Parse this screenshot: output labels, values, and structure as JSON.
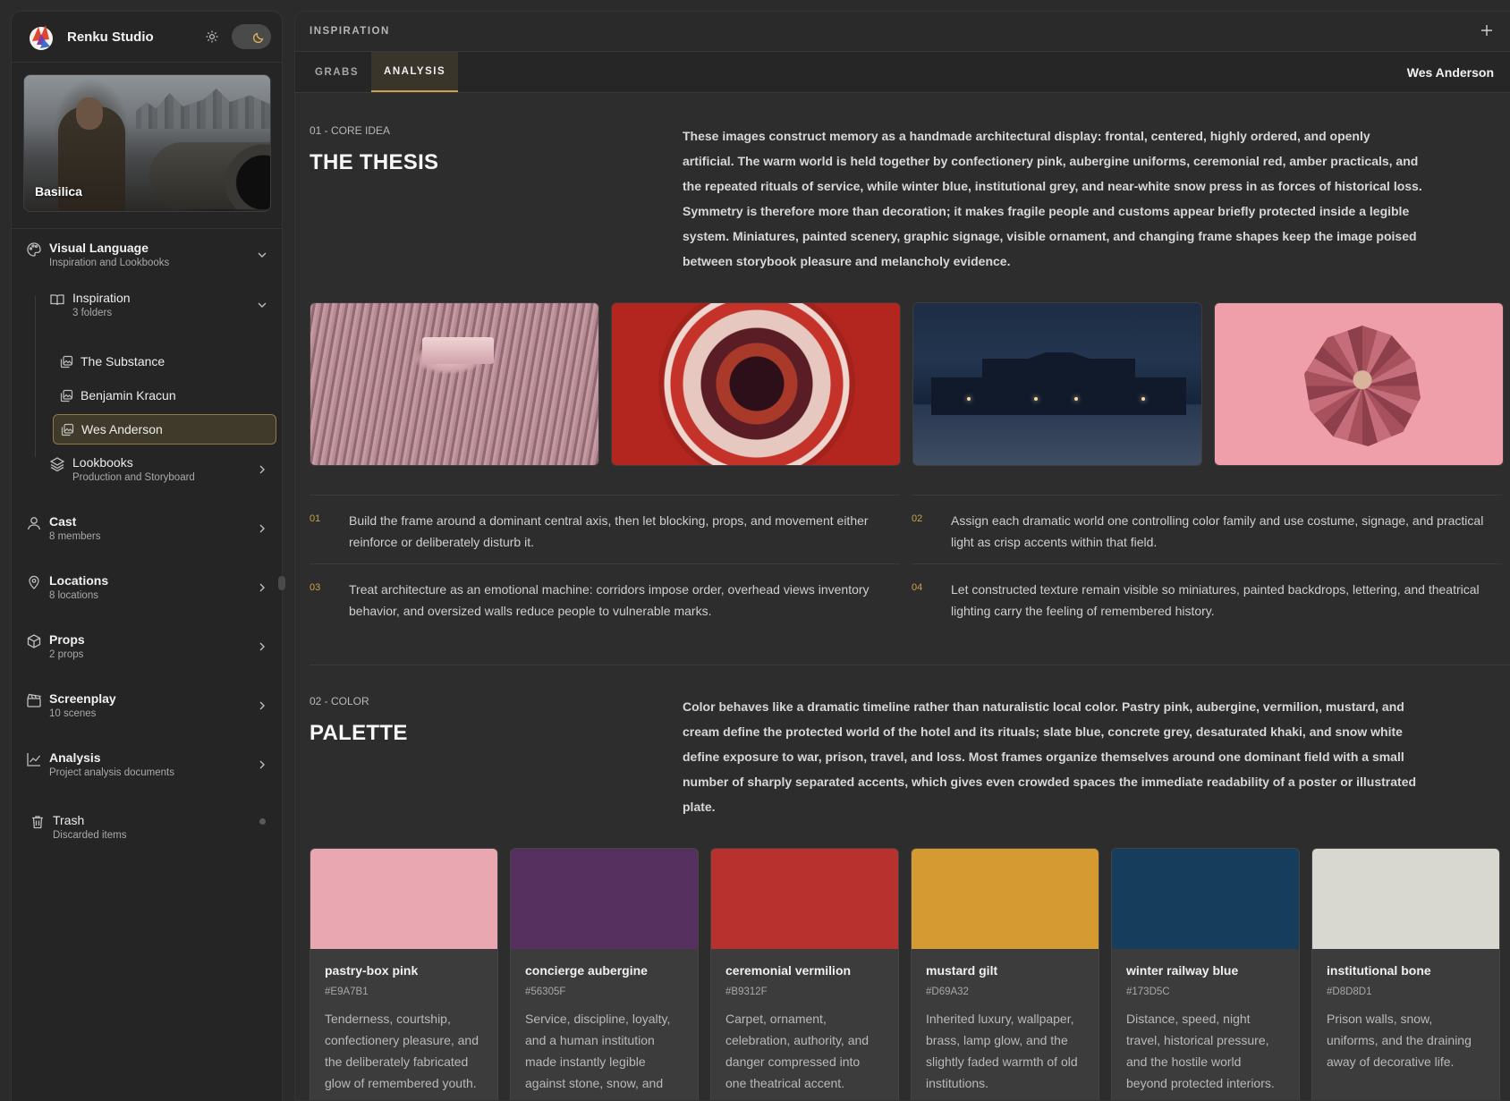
{
  "app": {
    "name": "Renku Studio"
  },
  "project": {
    "name": "Basilica"
  },
  "sidebar": {
    "visual_language": {
      "title": "Visual Language",
      "subtitle": "Inspiration and Lookbooks"
    },
    "inspiration": {
      "title": "Inspiration",
      "subtitle": "3 folders"
    },
    "folders": [
      "The Substance",
      "Benjamin Kracun",
      "Wes Anderson"
    ],
    "lookbooks": {
      "title": "Lookbooks",
      "subtitle": "Production and Storyboard"
    },
    "cast": {
      "title": "Cast",
      "subtitle": "8 members"
    },
    "locations": {
      "title": "Locations",
      "subtitle": "8 locations"
    },
    "props": {
      "title": "Props",
      "subtitle": "2 props"
    },
    "screenplay": {
      "title": "Screenplay",
      "subtitle": "10 scenes"
    },
    "analysis": {
      "title": "Analysis",
      "subtitle": "Project analysis documents"
    },
    "trash": {
      "title": "Trash",
      "subtitle": "Discarded items"
    }
  },
  "main": {
    "title": "INSPIRATION",
    "tabs": [
      "GRABS",
      "ANALYSIS"
    ],
    "active_tab": "ANALYSIS",
    "folder_name": "Wes Anderson"
  },
  "thesis": {
    "eyebrow": "01 - CORE IDEA",
    "heading": "THE THESIS",
    "body": "These images construct memory as a handmade architectural display: frontal, centered, highly ordered, and openly artificial. The warm world is held together by confectionery pink, aubergine uniforms, ceremonial red, amber practicals, and the repeated rituals of service, while winter blue, institutional grey, and near-white snow press in as forces of historical loss. Symmetry is therefore more than decoration; it makes fragile people and customs appear briefly protected inside a legible system. Miniatures, painted scenery, graphic signage, visible ornament, and changing frame shapes keep the image poised between storybook pleasure and melancholy evidence.",
    "principles": [
      {
        "num": "01",
        "text": "Build the frame around a dominant central axis, then let blocking, props, and movement either reinforce or deliberately disturb it."
      },
      {
        "num": "02",
        "text": "Assign each dramatic world one controlling color family and use costume, signage, and practical light as crisp accents within that field."
      },
      {
        "num": "03",
        "text": "Treat architecture as an emotional machine: corridors impose order, overhead views inventory behavior, and oversized walls reduce people to vulnerable marks."
      },
      {
        "num": "04",
        "text": "Let constructed texture remain visible so miniatures, painted backdrops, lettering, and theatrical lighting carry the feeling of remembered history."
      }
    ]
  },
  "palette": {
    "eyebrow": "02 - COLOR",
    "heading": "PALETTE",
    "body": "Color behaves like a dramatic timeline rather than naturalistic local color. Pastry pink, aubergine, vermilion, mustard, and cream define the protected world of the hotel and its rituals; slate blue, concrete grey, desaturated khaki, and snow white define exposure to war, prison, travel, and loss. Most frames organize themselves around one dominant field with a small number of sharply separated accents, which gives even crowded spaces the immediate readability of a poster or illustrated plate.",
    "swatches": [
      {
        "name": "pastry-box pink",
        "hex": "#E9A7B1",
        "desc": "Tenderness, courtship, confectionery pleasure, and the deliberately fabricated glow of remembered youth."
      },
      {
        "name": "concierge aubergine",
        "hex": "#56305F",
        "desc": "Service, discipline, loyalty, and a human institution made instantly legible against stone, snow, and"
      },
      {
        "name": "ceremonial vermilion",
        "hex": "#B9312F",
        "desc": "Carpet, ornament, celebration, authority, and danger compressed into one theatrical accent."
      },
      {
        "name": "mustard gilt",
        "hex": "#D69A32",
        "desc": "Inherited luxury, wallpaper, brass, lamp glow, and the slightly faded warmth of old institutions."
      },
      {
        "name": "winter railway blue",
        "hex": "#173D5C",
        "desc": "Distance, speed, night travel, historical pressure, and the hostile world beyond protected interiors."
      },
      {
        "name": "institutional bone",
        "hex": "#D8D8D1",
        "desc": "Prison walls, snow, uniforms, and the draining away of decorative life."
      }
    ]
  },
  "colors": {
    "accent": "#C9A14A",
    "active_folder_bg": "#3F3A2A"
  }
}
